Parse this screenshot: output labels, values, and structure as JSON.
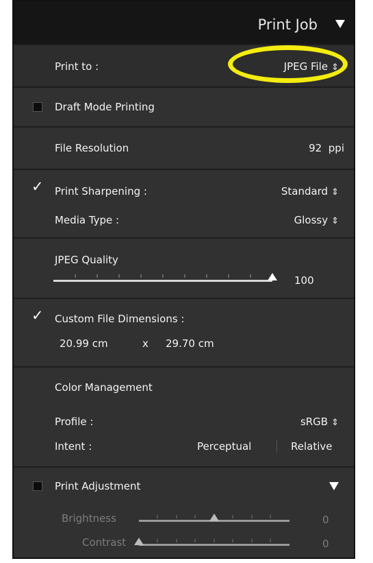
{
  "header": {
    "title": "Print Job"
  },
  "print_to": {
    "label": "Print to :",
    "value": "JPEG File"
  },
  "draft_mode": {
    "label": "Draft Mode Printing",
    "checked": false
  },
  "file_resolution": {
    "label": "File Resolution",
    "value": "92",
    "unit": "ppi"
  },
  "print_sharpening": {
    "label": "Print Sharpening :",
    "value": "Standard",
    "checked": true
  },
  "media_type": {
    "label": "Media Type :",
    "value": "Glossy"
  },
  "jpeg_quality": {
    "label": "JPEG Quality",
    "value": "100",
    "level": 1.0
  },
  "custom_dimensions": {
    "label": "Custom File Dimensions :",
    "checked": true,
    "width": "20.99 cm",
    "times": "x",
    "height": "29.70 cm"
  },
  "color_management": {
    "title": "Color Management",
    "profile_label": "Profile :",
    "profile_value": "sRGB",
    "intent_label": "Intent :",
    "intent_options": [
      "Perceptual",
      "Relative"
    ],
    "intent_selected": "Relative"
  },
  "print_adjustment": {
    "label": "Print Adjustment",
    "checked": false,
    "brightness_label": "Brightness",
    "brightness_value": "0",
    "brightness_level": 0.5,
    "contrast_label": "Contrast",
    "contrast_value": "0",
    "contrast_level": 0.0
  },
  "stepper_glyph": "⇕",
  "colors": {
    "panel_bg": "#313131",
    "header_bg": "#151515",
    "highlight": "#f4ec10"
  }
}
